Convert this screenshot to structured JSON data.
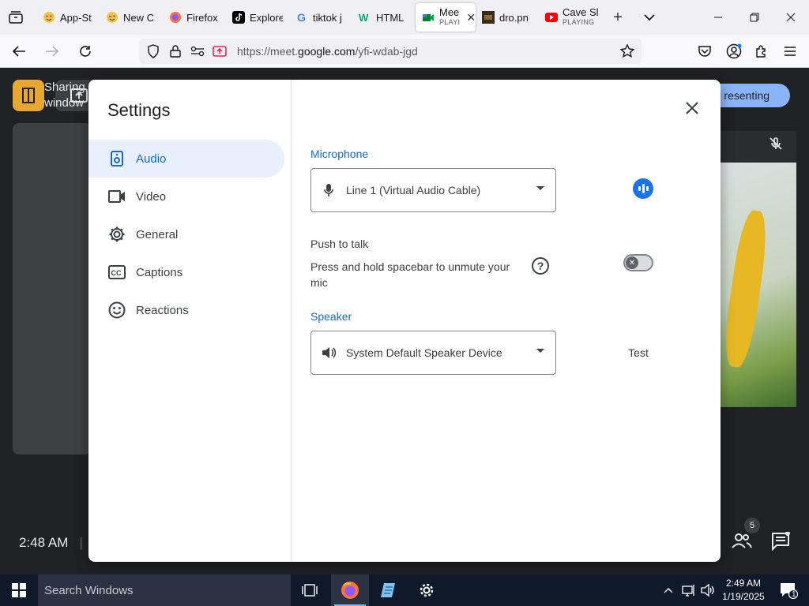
{
  "browser": {
    "tabs": [
      {
        "title": "App-St",
        "favicon": "emoji-smile-icon"
      },
      {
        "title": "New C",
        "favicon": "emoji-wink-icon"
      },
      {
        "title": "Firefox",
        "favicon": "firefox-icon"
      },
      {
        "title": "Explore",
        "favicon": "tiktok-icon"
      },
      {
        "title": "tiktok j",
        "favicon": "google-icon"
      },
      {
        "title": "HTML",
        "favicon": "w3-icon"
      },
      {
        "title": "Mee",
        "subtitle": "PLAYI",
        "favicon": "google-meet-icon",
        "active": true
      },
      {
        "title": "dro.pn",
        "favicon": "image-thumb-icon"
      },
      {
        "title": "Cave Sl",
        "subtitle": "PLAYING",
        "favicon": "youtube-icon"
      }
    ],
    "url_prefix": "https://meet.",
    "url_domain": "google.com",
    "url_path": "/yfi-wdab-jgd"
  },
  "meet": {
    "presenting_label": "resenting",
    "share_text_line1": "Sharing y",
    "share_text_line2": "window",
    "time": "2:48 AM",
    "time_divider": "|",
    "participants_count": "5"
  },
  "settings": {
    "title": "Settings",
    "nav": [
      {
        "label": "Audio",
        "icon": "speaker-icon",
        "active": true
      },
      {
        "label": "Video",
        "icon": "video-camera-icon"
      },
      {
        "label": "General",
        "icon": "gear-icon"
      },
      {
        "label": "Captions",
        "icon": "closed-captions-icon"
      },
      {
        "label": "Reactions",
        "icon": "smiley-icon"
      }
    ],
    "microphone": {
      "label": "Microphone",
      "value": "Line 1 (Virtual Audio Cable)"
    },
    "push_to_talk": {
      "title": "Push to talk",
      "description": "Press and hold spacebar to unmute your mic",
      "enabled": false
    },
    "speaker": {
      "label": "Speaker",
      "value": "System Default Speaker Device",
      "test_label": "Test"
    }
  },
  "taskbar": {
    "search_placeholder": "Search Windows",
    "time": "2:49 AM",
    "date": "1/19/2025",
    "notification_count": "1"
  },
  "colors": {
    "accent_blue": "#1a73e8",
    "active_nav_bg": "#e8f0fe",
    "active_nav_text": "#1967d2",
    "meet_bg": "#202124",
    "taskbar_bg": "#10192a"
  }
}
